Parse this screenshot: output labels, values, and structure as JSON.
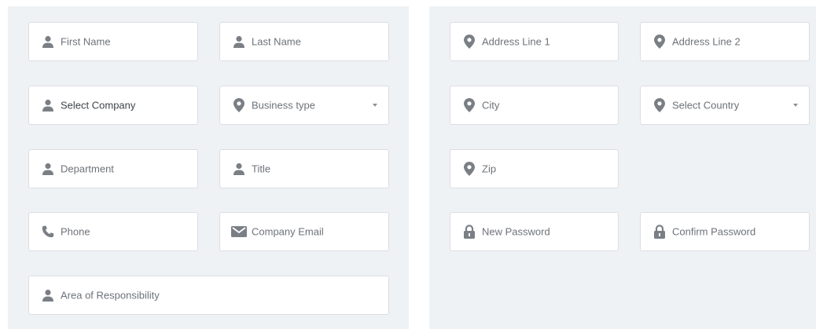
{
  "left_form": {
    "first_name": "First Name",
    "last_name": "Last Name",
    "select_company": "Select Company",
    "business_type": "Business type",
    "department": "Department",
    "title": "Title",
    "phone": "Phone",
    "company_email": "Company Email",
    "area_of_responsibility": "Area of Responsibility"
  },
  "right_form": {
    "address_line_1": "Address Line 1",
    "address_line_2": "Address Line 2",
    "city": "City",
    "select_country": "Select Country",
    "zip": "Zip",
    "new_password": "New Password",
    "confirm_password": "Confirm Password"
  },
  "icons": {
    "user": "user-icon",
    "location": "map-marker-icon",
    "phone": "phone-icon",
    "email": "envelope-icon",
    "lock": "lock-icon",
    "dropdown": "caret-down-icon"
  },
  "colors": {
    "panel_background": "#eff2f5",
    "field_background": "#ffffff",
    "field_border": "#dadde2",
    "icon": "#7a7f85",
    "placeholder_text": "#6d7278",
    "selected_text": "#3f4449"
  }
}
